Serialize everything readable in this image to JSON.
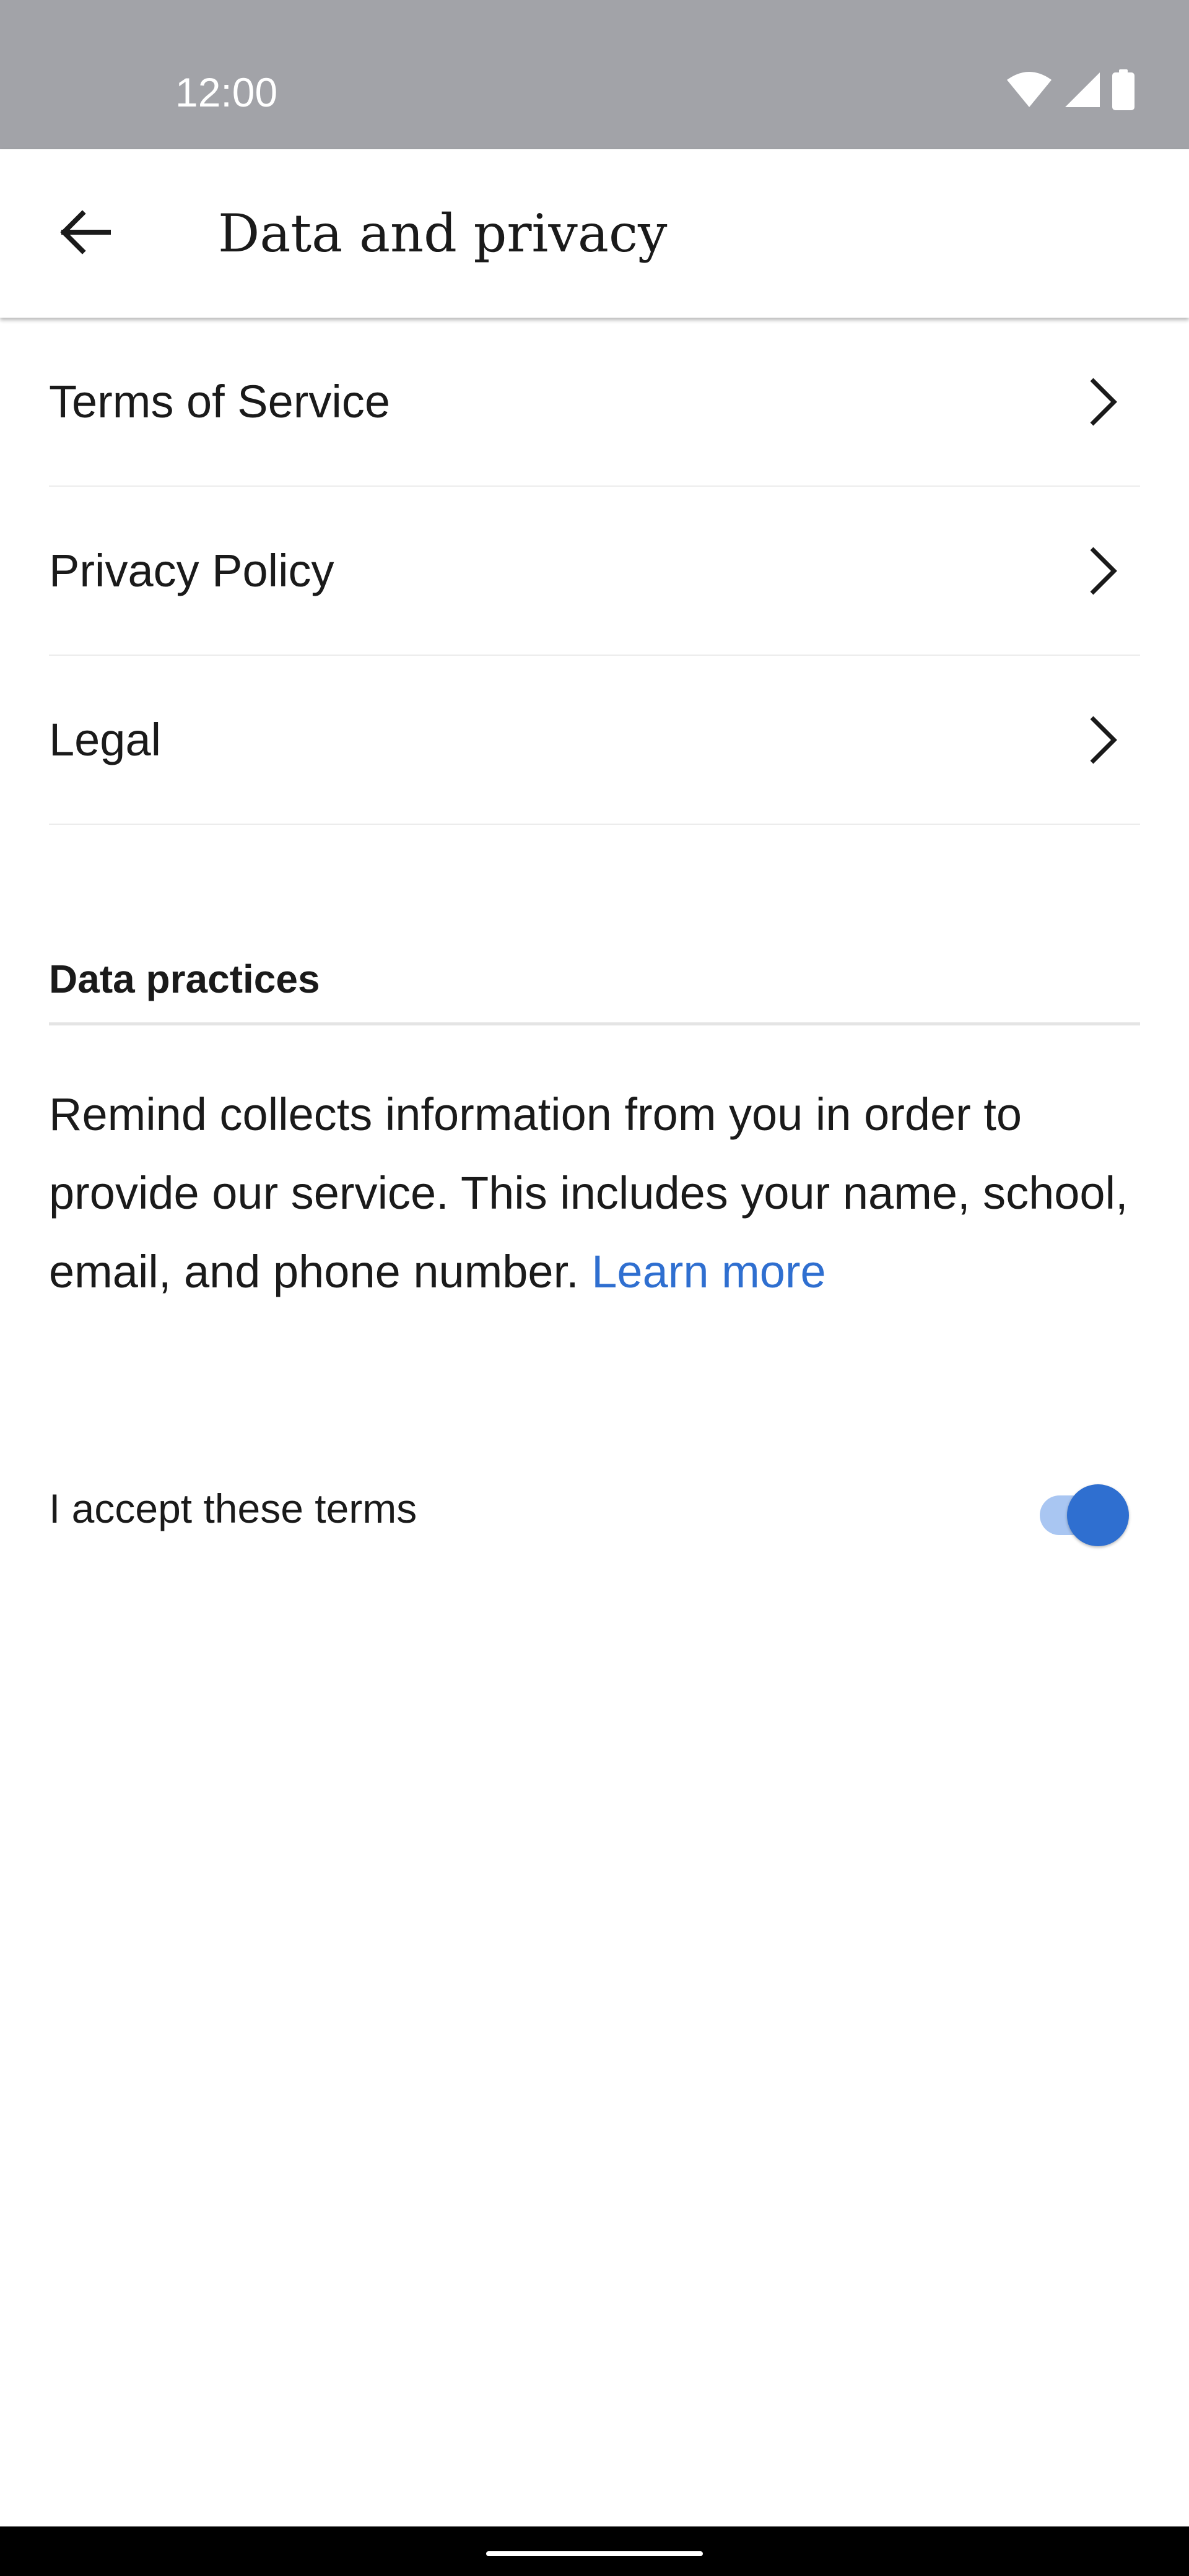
{
  "status_bar": {
    "time": "12:00",
    "icons": [
      "wifi-icon",
      "cellular-signal-icon",
      "battery-icon"
    ]
  },
  "app_bar": {
    "back_icon": "arrow-back-icon",
    "title": "Data and privacy"
  },
  "links": [
    {
      "label": "Terms of Service",
      "icon": "chevron-right-icon"
    },
    {
      "label": "Privacy Policy",
      "icon": "chevron-right-icon"
    },
    {
      "label": "Legal",
      "icon": "chevron-right-icon"
    }
  ],
  "data_practices": {
    "title": "Data practices",
    "body": "Remind collects information from you in order to provide our service. This includes your name, school, email, and phone number.",
    "learn_more": "Learn more"
  },
  "accept_terms": {
    "label": "I accept these terms",
    "checked": true
  },
  "colors": {
    "status_bar": "#a2a3a8",
    "accent": "#2f6fd0",
    "toggle_track": "#a9c6f2",
    "text": "#1a1a1a"
  }
}
